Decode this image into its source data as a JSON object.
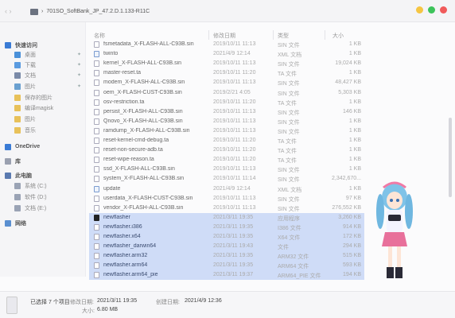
{
  "window": {
    "path": "701SO_SoftBank_JP_47.2.D.1.133-R11C",
    "colors": {
      "selection": "#cfdcf7",
      "accent": "#3a7bd5"
    }
  },
  "sidebar": {
    "items": [
      {
        "label": "快速访问",
        "icon": "star-icon",
        "head": true,
        "pinned": false
      },
      {
        "label": "桌面",
        "icon": "desktop-icon",
        "head": false,
        "pinned": true
      },
      {
        "label": "下载",
        "icon": "download-icon",
        "head": false,
        "pinned": true
      },
      {
        "label": "文档",
        "icon": "documents-icon",
        "head": false,
        "pinned": true
      },
      {
        "label": "图片",
        "icon": "pictures-icon",
        "head": false,
        "pinned": true
      },
      {
        "label": "保存的图片",
        "icon": "folder-icon",
        "head": false,
        "pinned": false
      },
      {
        "label": "编译magisk",
        "icon": "folder-icon",
        "head": false,
        "pinned": false
      },
      {
        "label": "图片",
        "icon": "folder-icon",
        "head": false,
        "pinned": false
      },
      {
        "label": "音乐",
        "icon": "folder-icon",
        "head": false,
        "pinned": false
      },
      {
        "label": "OneDrive",
        "icon": "cloud-icon",
        "head": true,
        "pinned": false
      },
      {
        "label": "库",
        "icon": "library-icon",
        "head": true,
        "pinned": false
      },
      {
        "label": "此电脑",
        "icon": "pc-icon",
        "head": true,
        "pinned": false
      },
      {
        "label": "系统 (C:)",
        "icon": "drive-icon",
        "head": false,
        "pinned": false
      },
      {
        "label": "软件 (D:)",
        "icon": "drive-icon",
        "head": false,
        "pinned": false
      },
      {
        "label": "文档 (E:)",
        "icon": "drive-icon",
        "head": false,
        "pinned": false
      },
      {
        "label": "网络",
        "icon": "network-icon",
        "head": true,
        "pinned": false
      }
    ]
  },
  "columns": {
    "name": "名称",
    "date": "修改日期",
    "type": "类型",
    "size": "大小"
  },
  "files": [
    {
      "name": "fsmetadata_X-FLASH-ALL-C93B.sin",
      "date": "2019/10/11 11:13",
      "type": "SIN 文件",
      "size": "1 KB",
      "kind": "file",
      "selected": false
    },
    {
      "name": "twinto",
      "date": "2021/4/9 12:14",
      "type": "XML 文档",
      "size": "1 KB",
      "kind": "xml",
      "selected": false
    },
    {
      "name": "kernel_X-FLASH-ALL-C93B.sin",
      "date": "2019/10/11 11:13",
      "type": "SIN 文件",
      "size": "19,024 KB",
      "kind": "file",
      "selected": false
    },
    {
      "name": "master-reset.ta",
      "date": "2019/10/11 11:20",
      "type": "TA 文件",
      "size": "1 KB",
      "kind": "file",
      "selected": false
    },
    {
      "name": "modem_X-FLASH-ALL-C93B.sin",
      "date": "2019/10/11 11:13",
      "type": "SIN 文件",
      "size": "48,427 KB",
      "kind": "file",
      "selected": false
    },
    {
      "name": "oem_X-FLASH-CUST-C93B.sin",
      "date": "2019/2/21 4:05",
      "type": "SIN 文件",
      "size": "5,303 KB",
      "kind": "file",
      "selected": false
    },
    {
      "name": "osv-restriction.ta",
      "date": "2019/10/11 11:20",
      "type": "TA 文件",
      "size": "1 KB",
      "kind": "file",
      "selected": false
    },
    {
      "name": "persist_X-FLASH-ALL-C93B.sin",
      "date": "2019/10/11 11:13",
      "type": "SIN 文件",
      "size": "146 KB",
      "kind": "file",
      "selected": false
    },
    {
      "name": "Qnovo_X-FLASH-ALL-C93B.sin",
      "date": "2019/10/11 11:13",
      "type": "SIN 文件",
      "size": "1 KB",
      "kind": "file",
      "selected": false
    },
    {
      "name": "ramdump_X-FLASH-ALL-C93B.sin",
      "date": "2019/10/11 11:13",
      "type": "SIN 文件",
      "size": "1 KB",
      "kind": "file",
      "selected": false
    },
    {
      "name": "reset-kernel-cmd-debug.ta",
      "date": "2019/10/11 11:20",
      "type": "TA 文件",
      "size": "1 KB",
      "kind": "file",
      "selected": false
    },
    {
      "name": "reset-non-secure-adb.ta",
      "date": "2019/10/11 11:20",
      "type": "TA 文件",
      "size": "1 KB",
      "kind": "file",
      "selected": false
    },
    {
      "name": "reset-wipe-reason.ta",
      "date": "2019/10/11 11:20",
      "type": "TA 文件",
      "size": "1 KB",
      "kind": "file",
      "selected": false
    },
    {
      "name": "ssd_X-FLASH-ALL-C93B.sin",
      "date": "2019/10/11 11:13",
      "type": "SIN 文件",
      "size": "1 KB",
      "kind": "file",
      "selected": false
    },
    {
      "name": "system_X-FLASH-ALL-C93B.sin",
      "date": "2019/10/11 11:14",
      "type": "SIN 文件",
      "size": "2,342,670...",
      "kind": "file",
      "selected": false
    },
    {
      "name": "update",
      "date": "2021/4/9 12:14",
      "type": "XML 文档",
      "size": "1 KB",
      "kind": "xml",
      "selected": false
    },
    {
      "name": "userdata_X-FLASH-CUST-C93B.sin",
      "date": "2019/10/11 11:13",
      "type": "SIN 文件",
      "size": "97 KB",
      "kind": "file",
      "selected": false
    },
    {
      "name": "vendor_X-FLASH-ALL-C93B.sin",
      "date": "2019/10/11 11:13",
      "type": "SIN 文件",
      "size": "276,552 KB",
      "kind": "file",
      "selected": false
    },
    {
      "name": "newflasher",
      "date": "2021/3/11 19:35",
      "type": "应用程序",
      "size": "3,260 KB",
      "kind": "exe",
      "selected": true
    },
    {
      "name": "newflasher.i386",
      "date": "2021/3/11 19:35",
      "type": "I386 文件",
      "size": "914 KB",
      "kind": "file",
      "selected": true
    },
    {
      "name": "newflasher.x64",
      "date": "2021/3/11 19:35",
      "type": "X64 文件",
      "size": "172 KB",
      "kind": "file",
      "selected": true
    },
    {
      "name": "newflasher_darwin64",
      "date": "2021/3/11 19:43",
      "type": "文件",
      "size": "294 KB",
      "kind": "file",
      "selected": true
    },
    {
      "name": "newflasher.arm32",
      "date": "2021/3/11 19:35",
      "type": "ARM32 文件",
      "size": "515 KB",
      "kind": "file",
      "selected": true
    },
    {
      "name": "newflasher.arm64",
      "date": "2021/3/11 19:35",
      "type": "ARM64 文件",
      "size": "593 KB",
      "kind": "file",
      "selected": true
    },
    {
      "name": "newflasher.arm64_pie",
      "date": "2021/3/11 19:37",
      "type": "ARM64_PIE 文件",
      "size": "194 KB",
      "kind": "file",
      "selected": true
    }
  ],
  "status": {
    "selected": "已选择 7 个项目",
    "modified_key": "修改日期:",
    "modified_val": "2021/3/11 19:35",
    "created_key": "创建日期:",
    "created_val": "2021/4/9 12:36",
    "size_key": "大小:",
    "size_val": "6.80 MB"
  }
}
